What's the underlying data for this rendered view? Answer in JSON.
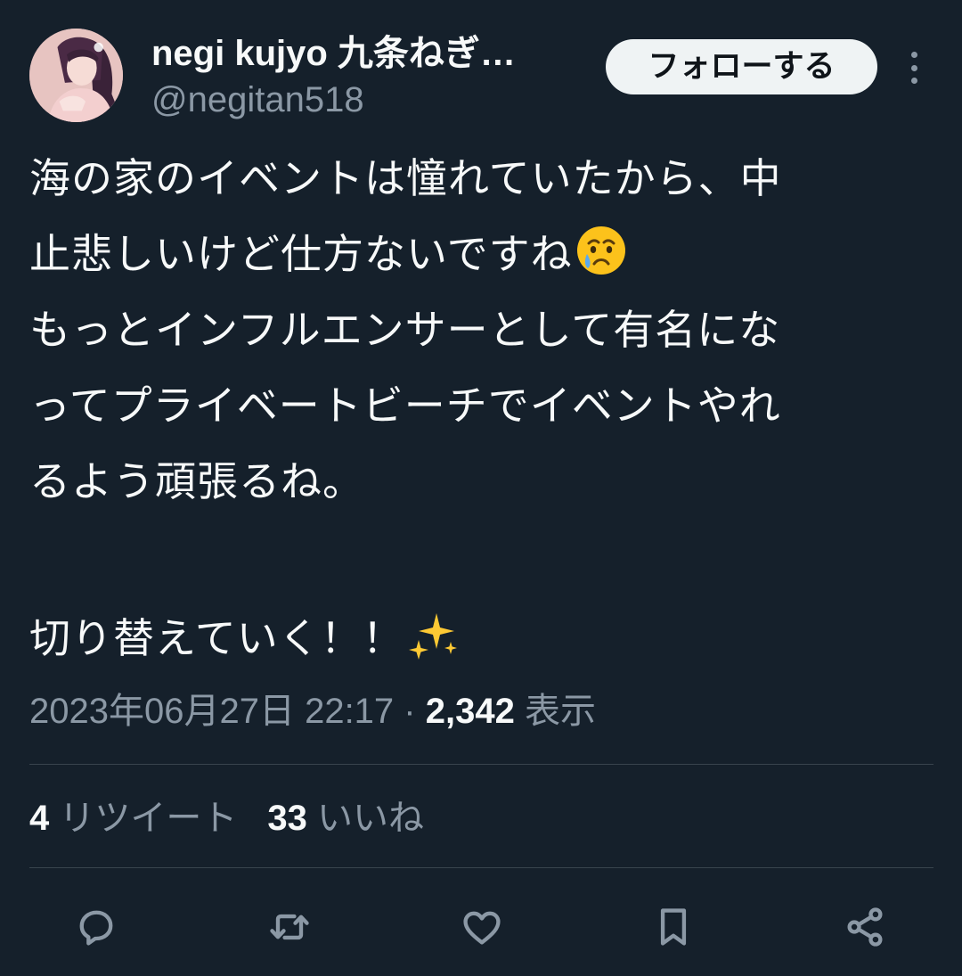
{
  "author": {
    "display_name": "negi kujyo 九条ねぎ…",
    "handle": "@negitan518",
    "follow_label": "フォローする"
  },
  "tweet": {
    "lines": [
      "海の家のイベントは憧れていたから、中",
      "止悲しいけど仕方ないですね",
      "もっとインフルエンサーとして有名にな",
      "ってプライベートビーチでイベントやれ",
      "るよう頑張るね。",
      "切り替えていく！！"
    ],
    "emojis": [
      "crying-face",
      "sparkles"
    ]
  },
  "meta": {
    "timestamp": "2023年06月27日 22:17",
    "separator": " · ",
    "views_count": "2,342",
    "views_label": " 表示"
  },
  "stats": {
    "retweets_count": "4",
    "retweets_label": " リツイート",
    "likes_count": "33",
    "likes_label": " いいね"
  },
  "actions": [
    "reply-icon",
    "retweet-icon",
    "like-icon",
    "bookmark-icon",
    "share-icon"
  ],
  "colors": {
    "background": "#15202b",
    "text": "#f7f9f9",
    "secondary_text": "#8b98a5",
    "divider": "#38444d",
    "follow_button_bg": "#eff3f4"
  }
}
